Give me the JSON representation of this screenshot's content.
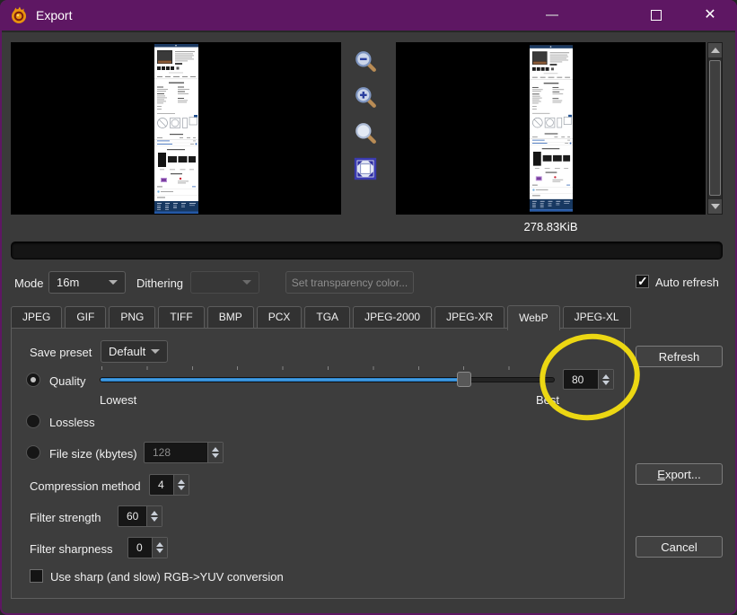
{
  "titlebar": {
    "title": "Export"
  },
  "preview": {
    "right_size_label": "278.83KiB"
  },
  "toolbar": {
    "mode_label": "Mode",
    "mode_value": "16m",
    "dithering_label": "Dithering",
    "dithering_value": "",
    "transparency_button_label": "Set transparency color...",
    "auto_refresh_label": "Auto refresh",
    "auto_refresh_checked": true
  },
  "tabs": {
    "items": [
      {
        "label": "JPEG"
      },
      {
        "label": "GIF"
      },
      {
        "label": "PNG"
      },
      {
        "label": "TIFF"
      },
      {
        "label": "BMP"
      },
      {
        "label": "PCX"
      },
      {
        "label": "TGA"
      },
      {
        "label": "JPEG-2000"
      },
      {
        "label": "JPEG-XR"
      },
      {
        "label": "WebP"
      },
      {
        "label": "JPEG-XL"
      }
    ],
    "active": "WebP"
  },
  "panel": {
    "save_preset_label": "Save preset",
    "save_preset_value": "Default",
    "quality_label": "Quality",
    "quality_selected": true,
    "quality_value": "80",
    "quality_percent": 80,
    "quality_min_label": "Lowest",
    "quality_max_label": "Best",
    "lossless_label": "Lossless",
    "file_size_label": "File size (kbytes)",
    "file_size_value": "128",
    "compression_label": "Compression method",
    "compression_value": "4",
    "filter_strength_label": "Filter strength",
    "filter_strength_value": "60",
    "filter_sharpness_label": "Filter sharpness",
    "filter_sharpness_value": "0",
    "sharp_yuv_label": "Use sharp (and slow) RGB->YUV conversion"
  },
  "actions": {
    "refresh": "Refresh",
    "export_mnemonic": "E",
    "export_rest": "xport...",
    "cancel": "Cancel"
  },
  "colors": {
    "titlebar_purple": "#5e1763",
    "slider_blue": "#2f8fdd",
    "annotation_yellow": "#ecd713"
  }
}
